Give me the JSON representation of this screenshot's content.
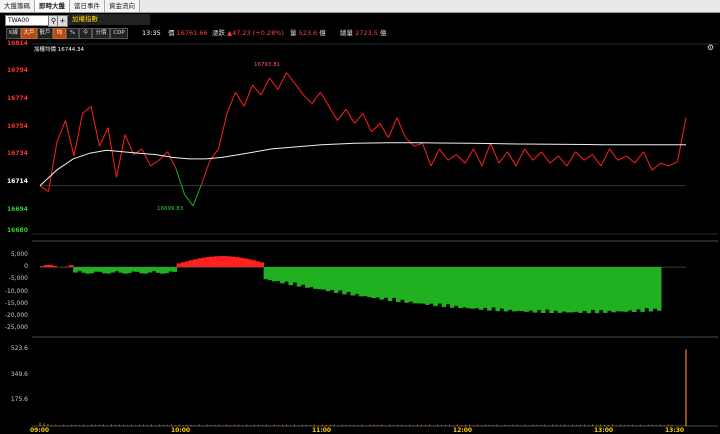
{
  "tabs": [
    "大盤籌碼",
    "即時大盤",
    "當日事件",
    "資金流向"
  ],
  "active_tab": 1,
  "symbol": {
    "value": "TWA00",
    "name": "加權指數"
  },
  "mode_buttons": [
    "K線",
    "大戶",
    "散戶",
    "均",
    "%",
    "今",
    "分價",
    "CDP"
  ],
  "mode_active": [
    1,
    3
  ],
  "quote": {
    "time": "13:35",
    "price_label": "價",
    "price": "16761.66",
    "change_label": "漲跌",
    "change": "▲47.23 (+0.28%)",
    "volume_label": "量",
    "volume": "523.6",
    "unit": "億",
    "total_label": "總量",
    "total": "2723.5",
    "unit2": "億"
  },
  "legend": {
    "label": "加權均價",
    "value": "16744.34"
  },
  "main_ylabels": [
    {
      "text": "16814",
      "color": "red"
    },
    {
      "text": "16794",
      "color": "red"
    },
    {
      "text": "16774",
      "color": "red"
    },
    {
      "text": "16754",
      "color": "red"
    },
    {
      "text": "16734",
      "color": "red"
    },
    {
      "text": "16714",
      "color": "white"
    },
    {
      "text": "16694",
      "color": "green"
    },
    {
      "text": "16680",
      "color": "green"
    }
  ],
  "annotations": {
    "high": "16793.81",
    "low": "16699.83"
  },
  "diff_ylabels": [
    "5,000",
    "0",
    "-5,000",
    "-10,000",
    "-15,000",
    "-20,000",
    "-25,000"
  ],
  "vol_ylabels": [
    "523.6",
    "349.6",
    "175.6"
  ],
  "xlabels": [
    "09:00",
    "10:00",
    "11:00",
    "12:00",
    "13:00",
    "13:30"
  ],
  "colors": {
    "up": "#ff2020",
    "down": "#20b020",
    "avg": "#f0f0f0",
    "vol": "#ff8020"
  },
  "chart_data": {
    "type": "line",
    "x_range": [
      "09:00",
      "13:30"
    ],
    "series": [
      {
        "name": "加權指數",
        "values": [
          16714,
          16710,
          16745,
          16760,
          16735,
          16765,
          16770,
          16742,
          16755,
          16720,
          16750,
          16736,
          16740,
          16728,
          16732,
          16738,
          16726,
          16708,
          16699.83,
          16715,
          16732,
          16740,
          16765,
          16780,
          16770,
          16785,
          16778,
          16790,
          16782,
          16793.81,
          16786,
          16778,
          16772,
          16780,
          16770,
          16760,
          16768,
          16758,
          16765,
          16752,
          16758,
          16748,
          16762,
          16748,
          16742,
          16744,
          16728,
          16740,
          16732,
          16736,
          16730,
          16740,
          16728,
          16744,
          16730,
          16738,
          16728,
          16740,
          16732,
          16738,
          16730,
          16735,
          16728,
          16738,
          16732,
          16736,
          16728,
          16740,
          16732,
          16735,
          16730,
          16738,
          16725,
          16730,
          16728,
          16731,
          16762
        ]
      },
      {
        "name": "加權均價",
        "values": [
          16714,
          16725,
          16733,
          16737,
          16739,
          16738,
          16737,
          16736,
          16734,
          16733,
          16733,
          16734,
          16736,
          16738,
          16740,
          16741,
          16742,
          16743,
          16743.5,
          16744,
          16744.2,
          16744.3,
          16744.34,
          16744.3,
          16744.2,
          16744.1,
          16744,
          16743.8,
          16743.6,
          16743.5,
          16743.4,
          16743.3,
          16743.2,
          16743.1,
          16743,
          16742.9,
          16742.9,
          16742.9,
          16743,
          16743
        ]
      }
    ],
    "ylim": [
      16680,
      16814
    ],
    "diff_ylim": [
      -27000,
      7000
    ],
    "vol_ylim": [
      0,
      560
    ]
  }
}
